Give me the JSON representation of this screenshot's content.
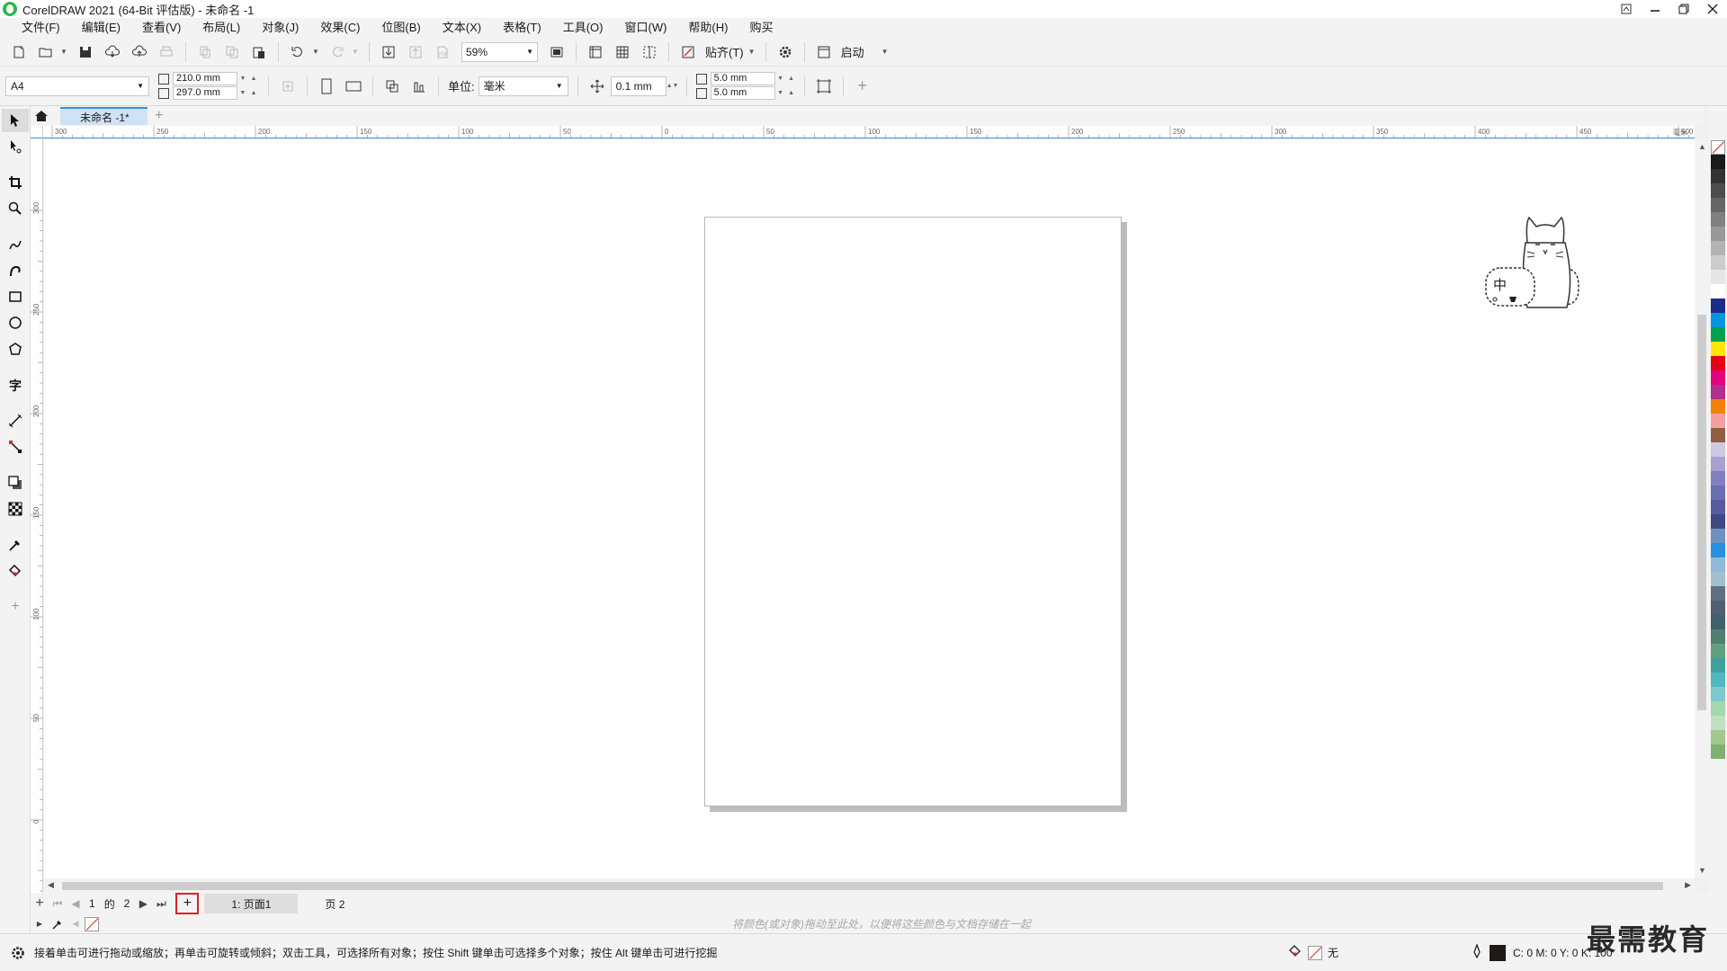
{
  "window": {
    "title": "CorelDRAW 2021 (64-Bit 评估版) - 未命名 -1",
    "controls": [
      "minimize-icon",
      "restore-icon",
      "close-icon"
    ]
  },
  "menubar": {
    "items": [
      "文件(F)",
      "编辑(E)",
      "查看(V)",
      "布局(L)",
      "对象(J)",
      "效果(C)",
      "位图(B)",
      "文本(X)",
      "表格(T)",
      "工具(O)",
      "窗口(W)",
      "帮助(H)",
      "购买"
    ]
  },
  "toolbar": {
    "zoom": "59%",
    "snap_label": "贴齐(T)",
    "launch_label": "启动"
  },
  "propbar": {
    "page_size": "A4",
    "width": "210.0 mm",
    "height": "297.0 mm",
    "units_label": "单位:",
    "units_value": "毫米",
    "nudge": "0.1 mm",
    "dup_x": "5.0 mm",
    "dup_y": "5.0 mm"
  },
  "doc_tab": {
    "label": "未命名 -1*"
  },
  "ruler": {
    "h_ticks": [
      "300",
      "250",
      "200",
      "150",
      "100",
      "50",
      "0",
      "50",
      "100",
      "150",
      "200",
      "250",
      "300",
      "350",
      "400",
      "450",
      "500"
    ],
    "h_unit": "毫米",
    "v_ticks": [
      "300",
      "250",
      "200",
      "150",
      "100",
      "50",
      "0"
    ]
  },
  "pagenav": {
    "current": "1",
    "of_label": "的",
    "total": "2",
    "tabs": [
      "1: 页面1",
      "页 2"
    ]
  },
  "colorwell": {
    "hint": "将颜色(或对象)拖动至此处，以便将这些颜色与文档存储在一起"
  },
  "status": {
    "message": "接着单击可进行拖动或缩放；再单击可旋转或倾斜；双击工具，可选择所有对象；按住 Shift 键单击可选择多个对象；按住 Alt 键单击可进行挖掘",
    "fill_label": "无",
    "outline_readout": "C: 0 M: 0 Y: 0 K: 100"
  },
  "mascot": {
    "text": "中"
  },
  "watermark": "最需教育",
  "palette_colors": [
    "#1a1a1a",
    "#333333",
    "#4d4d4d",
    "#666666",
    "#808080",
    "#999999",
    "#b3b3b3",
    "#cccccc",
    "#e6e6e6",
    "#ffffff",
    "#1c2c8c",
    "#0096e0",
    "#00a050",
    "#ffe600",
    "#e60012",
    "#e4007f",
    "#b0308c",
    "#f08200",
    "#f4a0a0",
    "#8c6040",
    "#d0c8e0",
    "#a8a0d0",
    "#8080c0",
    "#6870b0",
    "#5a5aa0",
    "#404880",
    "#7090c0",
    "#2890e0",
    "#90b8d8",
    "#a0c0d0",
    "#607080",
    "#506070",
    "#40606a",
    "#508070",
    "#60a080",
    "#40a0a0",
    "#50b8c0",
    "#80c8d0",
    "#a0d8b0",
    "#c0e0c0",
    "#a0c890",
    "#80b070"
  ]
}
